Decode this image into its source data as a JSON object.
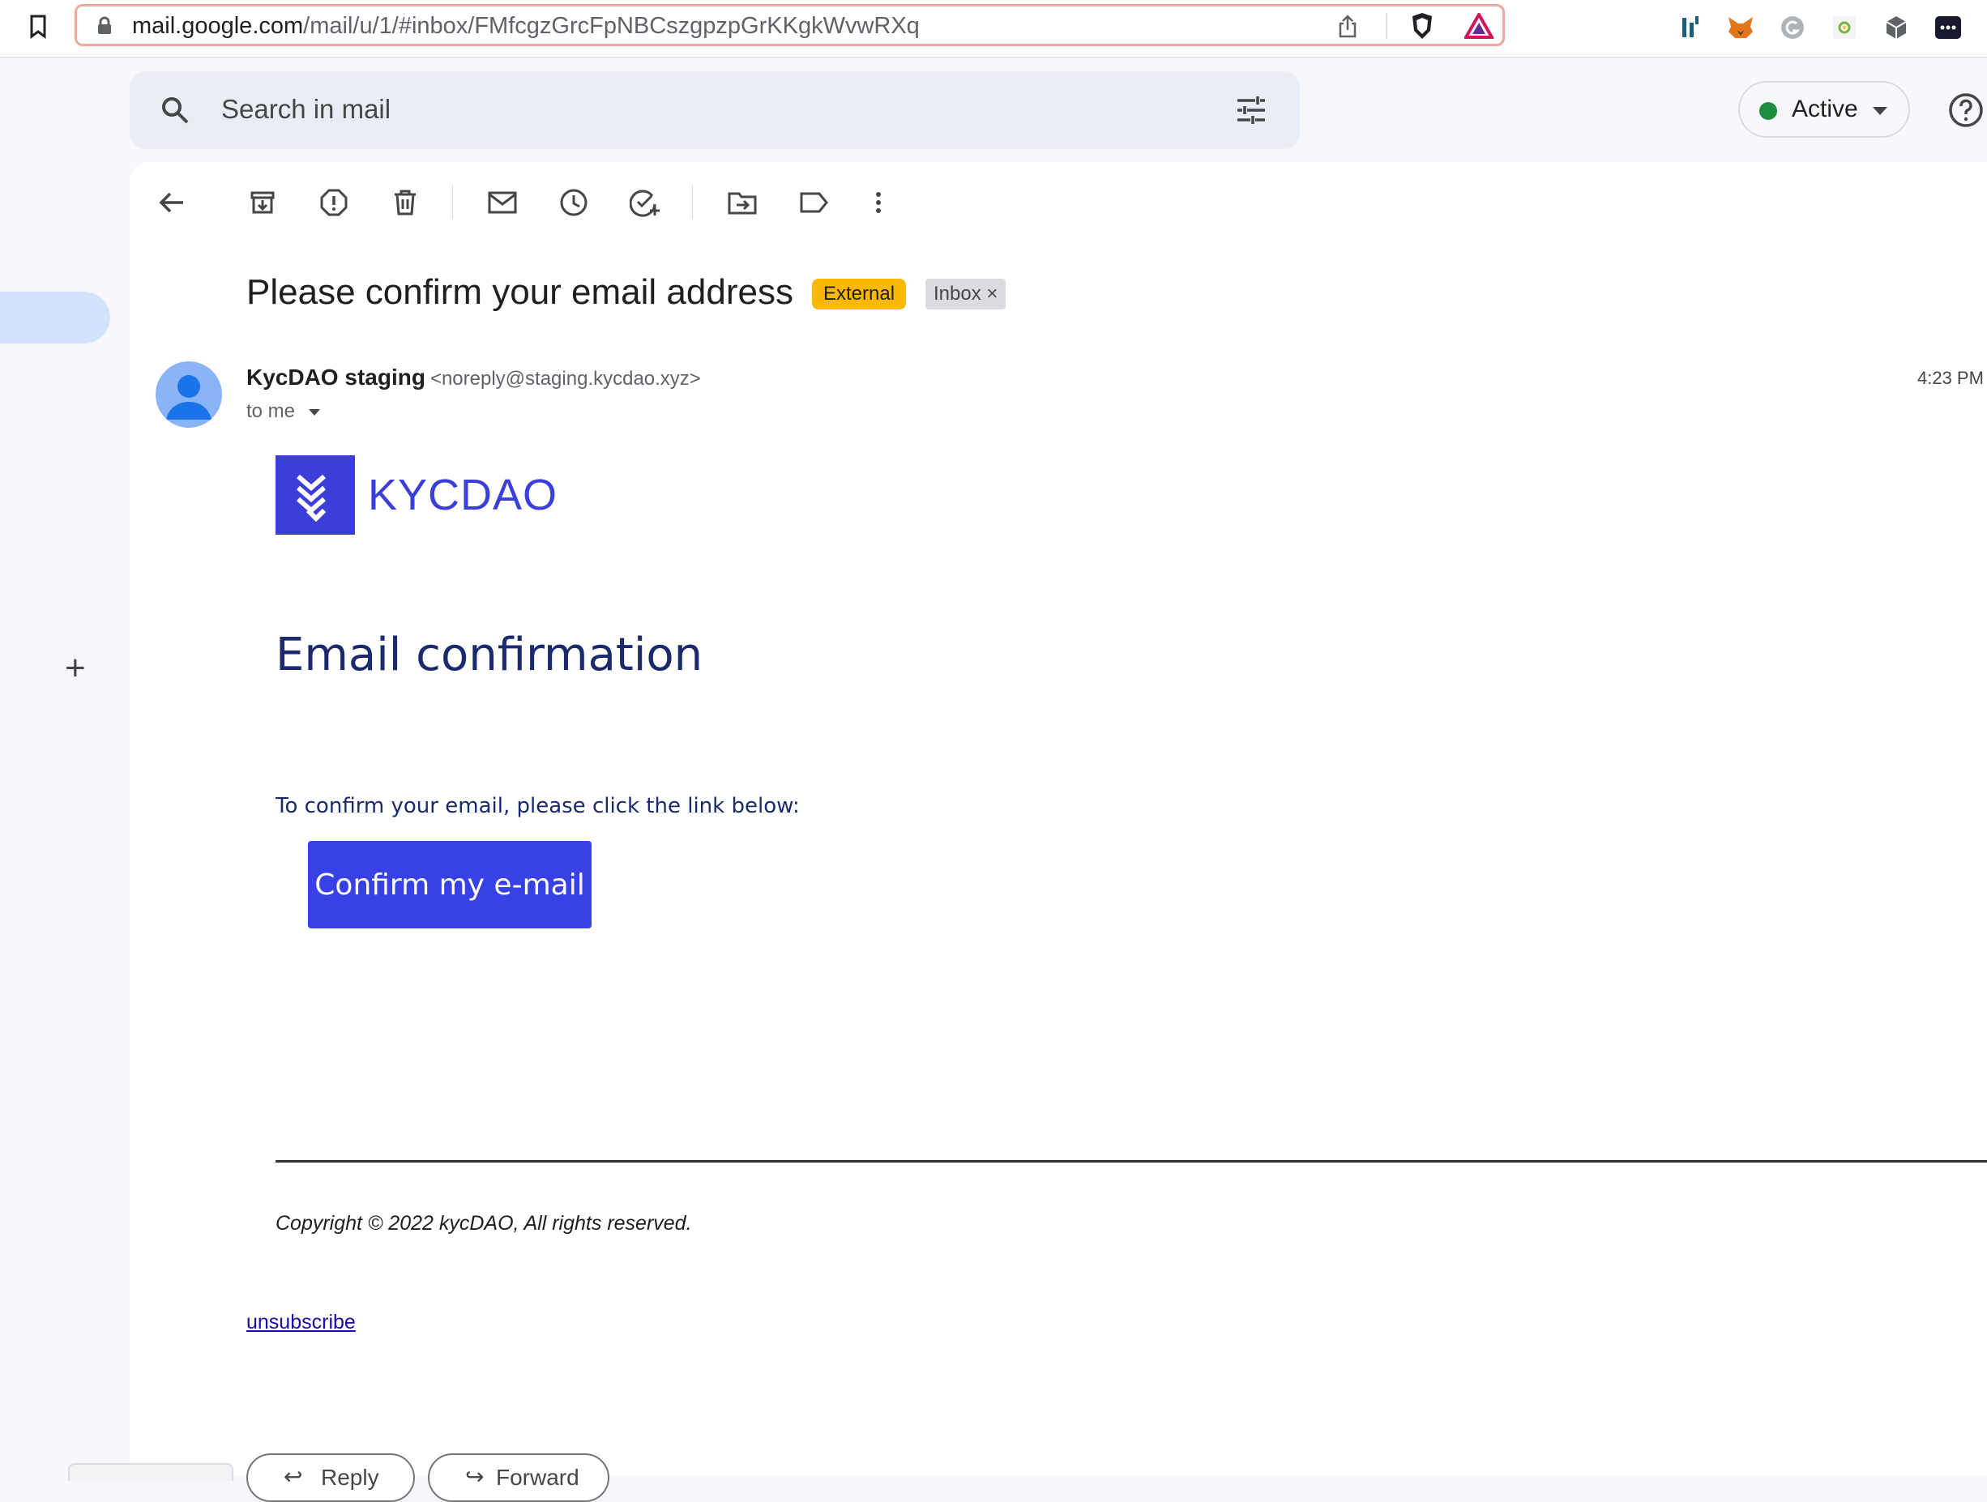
{
  "browser": {
    "url_host": "mail.google.com",
    "url_path": "/mail/u/1/#inbox/FMfcgzGrcFpNBCszgpzpGrKKgkWvwRXq"
  },
  "search": {
    "placeholder": "Search in mail"
  },
  "status": {
    "label": "Active"
  },
  "toolbar": {
    "icons": [
      "back-arrow-icon",
      "archive-icon",
      "report-spam-icon",
      "delete-icon",
      "mark-unread-icon",
      "snooze-icon",
      "add-task-icon",
      "move-to-icon",
      "label-icon",
      "more-icon"
    ]
  },
  "email": {
    "subject": "Please confirm your email address",
    "badge_external": "External",
    "badge_inbox": "Inbox",
    "badge_remove": "×",
    "sender_name": "KycDAO staging",
    "sender_email": "<noreply@staging.kycdao.xyz>",
    "to": "to me",
    "time": "4:23 PM",
    "logo_text": "KYCDAO",
    "heading": "Email confirmation",
    "body_text": "To confirm your email, please click the link below:",
    "button_label": "Confirm my e-mail",
    "copyright": "Copyright © 2022 kycDAO, All rights reserved.",
    "unsubscribe": "unsubscribe"
  },
  "actions": {
    "reply": "Reply",
    "forward": "Forward"
  },
  "colors": {
    "brand_blue": "#3b3ed9",
    "button_blue": "#3741e6",
    "external_badge": "#f9b801",
    "active_dot": "#1e8e3e"
  }
}
